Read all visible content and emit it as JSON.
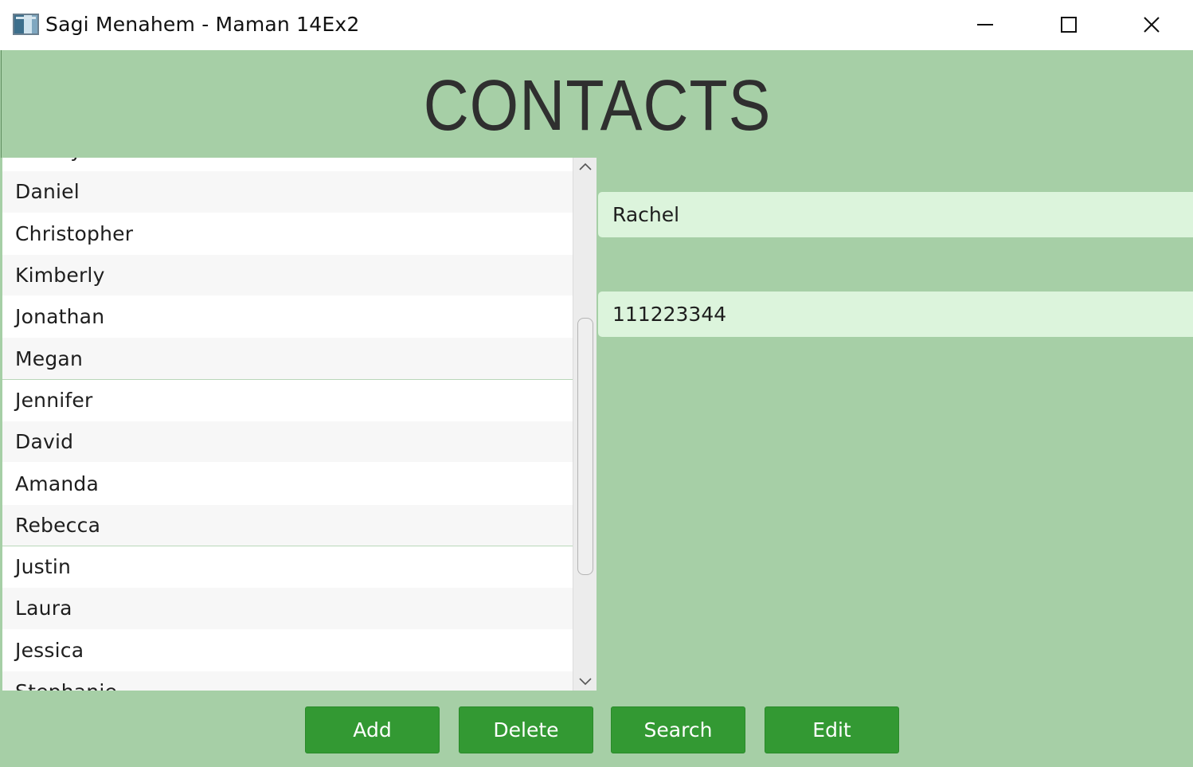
{
  "window": {
    "title": "Sagi Menahem - Maman 14Ex2"
  },
  "header": {
    "title": "CONTACTS"
  },
  "contacts_list": {
    "items": [
      "Ashley",
      "Daniel",
      "Christopher",
      "Kimberly",
      "Jonathan",
      "Megan",
      "Jennifer",
      "David",
      "Amanda",
      "Rebecca",
      "Justin",
      "Laura",
      "Jessica",
      "Stephanie"
    ]
  },
  "details": {
    "name": "Rachel",
    "phone": "111223344"
  },
  "buttons": {
    "add": "Add",
    "delete": "Delete",
    "search": "Search",
    "edit": "Edit"
  },
  "colors": {
    "background": "#a6cfa6",
    "field_background": "#dcf4dc",
    "button": "#339933",
    "title_text": "#2f2f2f"
  }
}
